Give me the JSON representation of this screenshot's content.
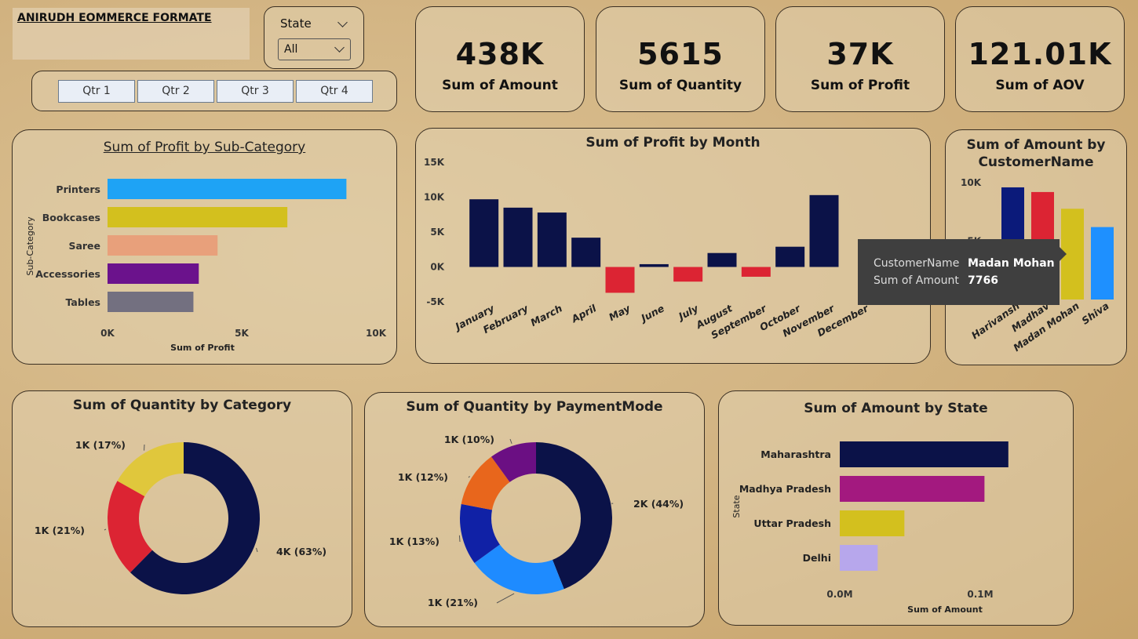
{
  "report_title": "ANIRUDH EOMMERCE   FORMATE",
  "filter": {
    "label": "State",
    "value": "All"
  },
  "quarters": [
    "Qtr 1",
    "Qtr 2",
    "Qtr 3",
    "Qtr 4"
  ],
  "kpis": [
    {
      "value": "438K",
      "label": "Sum of Amount"
    },
    {
      "value": "5615",
      "label": "Sum of Quantity"
    },
    {
      "value": "37K",
      "label": "Sum of Profit"
    },
    {
      "value": "121.01K",
      "label": "Sum of AOV"
    }
  ],
  "tooltip": {
    "k1": "CustomerName",
    "v1": "Madan Mohan",
    "k2": "Sum of Amount",
    "v2": "7766"
  },
  "chart_data": [
    {
      "type": "bar",
      "orientation": "horizontal",
      "title": "Sum of Profit by Sub-Category",
      "xlabel": "Sum of Profit",
      "ylabel": "Sub-Category",
      "categories": [
        "Printers",
        "Bookcases",
        "Saree",
        "Accessories",
        "Tables"
      ],
      "values": [
        8900,
        6700,
        4100,
        3400,
        3200
      ],
      "colors": [
        "#1ea3f5",
        "#d3c01e",
        "#e8a07b",
        "#6b128c",
        "#737080"
      ],
      "xticks": [
        "0K",
        "5K",
        "10K"
      ],
      "xlim": [
        0,
        10000
      ]
    },
    {
      "type": "bar",
      "title": "Sum of Profit by Month",
      "categories": [
        "January",
        "February",
        "March",
        "April",
        "May",
        "June",
        "July",
        "August",
        "September",
        "October",
        "November",
        "December"
      ],
      "values": [
        9700,
        8500,
        7800,
        4200,
        -3700,
        400,
        -2100,
        2000,
        -1400,
        2900,
        10300,
        0
      ],
      "yticks": [
        "15K",
        "10K",
        "5K",
        "0K",
        "-5K"
      ],
      "ylim": [
        -5000,
        15000
      ],
      "positive_color": "#0b1248",
      "negative_color": "#dc2433"
    },
    {
      "type": "bar",
      "title": "Sum of Amount by CustomerName",
      "categories": [
        "Harivansh",
        "Madhav",
        "Madan Mohan",
        "Shiva"
      ],
      "values": [
        9600,
        9200,
        7766,
        6200
      ],
      "colors": [
        "#0b1a7a",
        "#dc2433",
        "#d3c01e",
        "#1e90ff"
      ],
      "yticks": [
        "10K",
        "5K",
        "0K"
      ],
      "ylim": [
        0,
        10000
      ]
    },
    {
      "type": "pie",
      "title": "Sum of Quantity by Category",
      "slices": [
        {
          "label": "4K (63%)",
          "value": 63,
          "color": "#0b1248"
        },
        {
          "label": "1K (21%)",
          "value": 21,
          "color": "#dc2433"
        },
        {
          "label": "1K (17%)",
          "value": 17,
          "color": "#e0c73c"
        }
      ]
    },
    {
      "type": "pie",
      "title": "Sum of Quantity by PaymentMode",
      "slices": [
        {
          "label": "2K (44%)",
          "value": 44,
          "color": "#0b1248"
        },
        {
          "label": "1K (21%)",
          "value": 21,
          "color": "#1e8bff"
        },
        {
          "label": "1K (13%)",
          "value": 13,
          "color": "#1021a6"
        },
        {
          "label": "1K (12%)",
          "value": 12,
          "color": "#e8661c"
        },
        {
          "label": "1K (10%)",
          "value": 10,
          "color": "#6b0f83"
        }
      ]
    },
    {
      "type": "bar",
      "orientation": "horizontal",
      "title": "Sum of Amount by State",
      "xlabel": "Sum of Amount",
      "ylabel": "State",
      "categories": [
        "Maharashtra",
        "Madhya Pradesh",
        "Uttar Pradesh",
        "Delhi"
      ],
      "values": [
        0.12,
        0.103,
        0.046,
        0.027
      ],
      "colors": [
        "#0b1248",
        "#a3197f",
        "#d3c01e",
        "#b7a7ec"
      ],
      "xticks": [
        "0.0M",
        "0.1M"
      ],
      "xlim": [
        0,
        0.1
      ]
    }
  ]
}
